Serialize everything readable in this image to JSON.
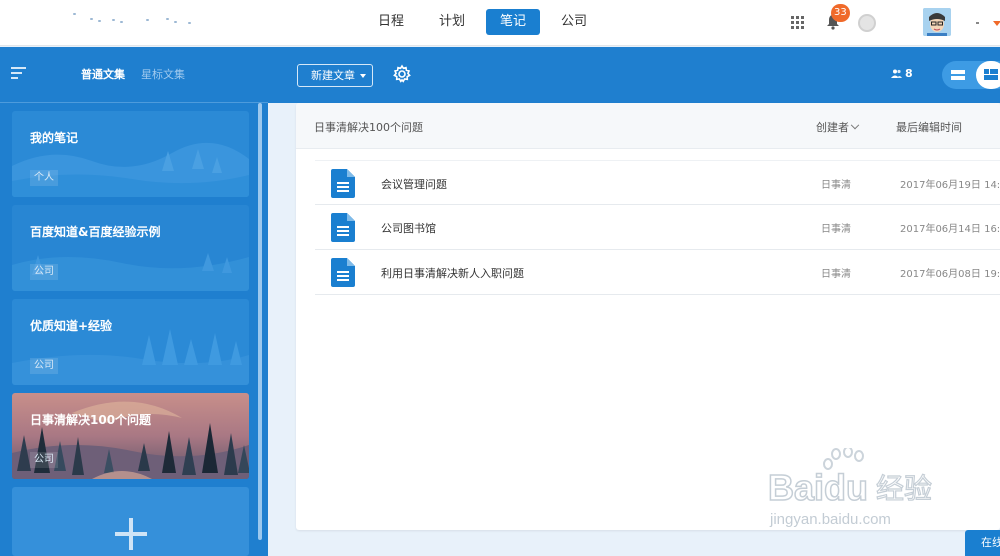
{
  "topbar": {
    "nav": [
      {
        "label": "日程",
        "active": false
      },
      {
        "label": "计划",
        "active": false
      },
      {
        "label": "笔记",
        "active": true
      },
      {
        "label": "公司",
        "active": false
      }
    ],
    "notification_count": "33",
    "accent_color": "#1a7fd0",
    "badge_color": "#f06a2a"
  },
  "sidebar": {
    "tabs": [
      {
        "label": "普通文集",
        "active": true
      },
      {
        "label": "星标文集",
        "active": false
      }
    ],
    "notebooks": [
      {
        "title": "我的笔记",
        "tag": "个人",
        "selected": false
      },
      {
        "title": "百度知道&百度经验示例",
        "tag": "公司",
        "selected": false
      },
      {
        "title": "优质知道+经验",
        "tag": "公司",
        "selected": false
      },
      {
        "title": "日事清解决100个问题",
        "tag": "公司",
        "selected": true
      }
    ],
    "background_color": "#1f7fcf"
  },
  "toolbar": {
    "new_article_label": "新建文章",
    "members_count": "8"
  },
  "notebook_panel": {
    "title": "日事清解决100个问题",
    "col_creator": "创建者",
    "col_time": "最后编辑时间",
    "rows": [
      {
        "title": "会议管理问题",
        "creator": "日事清",
        "time": "2017年06月19日 14:"
      },
      {
        "title": "公司图书馆",
        "creator": "日事清",
        "time": "2017年06月14日 16:"
      },
      {
        "title": "利用日事清解决新人入职问题",
        "creator": "日事清",
        "time": "2017年06月08日 19:"
      }
    ]
  },
  "online_button_label": "在线",
  "watermark": {
    "brand": "Baidu",
    "suffix": "经验",
    "url": "jingyan.baidu.com"
  }
}
